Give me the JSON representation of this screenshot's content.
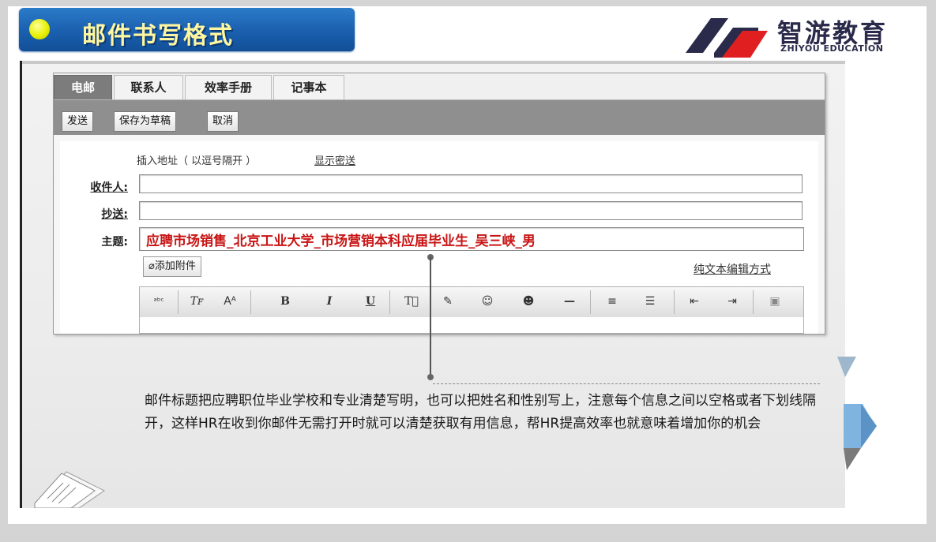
{
  "slide": {
    "title": "邮件书写格式",
    "logo": {
      "cn": "智游教育",
      "en": "ZHIYOU  EDUCATION"
    }
  },
  "mail_client": {
    "tabs": [
      {
        "label": "电邮",
        "active": true
      },
      {
        "label": "联系人",
        "active": false
      },
      {
        "label": "效率手册",
        "active": false
      },
      {
        "label": "记事本",
        "active": false
      }
    ],
    "toolbar": {
      "send": "发送",
      "save_draft": "保存为草稿",
      "cancel": "取消"
    },
    "compose": {
      "address_hint": "插入地址（ 以逗号隔开 ）",
      "show_bcc": "显示密送",
      "to_label": "收件人:",
      "to_value": "",
      "cc_label": "抄送:",
      "cc_value": "",
      "subject_label": "主题:",
      "subject_value": "应聘市场销售_北京工业大学_市场营销本科应届毕业生_吴三峡_男",
      "attach": "添加附件",
      "plain_text_mode": "纯文本编辑方式"
    },
    "editor_toolbar": [
      "spellcheck-icon",
      "font-icon",
      "font-size-icon",
      "bold-icon",
      "italic-icon",
      "underline-icon",
      "text-color-icon",
      "highlight-icon",
      "emoticon-icon",
      "emoticon-alt-icon",
      "horizontal-rule-icon",
      "align-icon",
      "list-icon",
      "outdent-icon",
      "indent-icon",
      "image-icon"
    ],
    "editor_glyphs": {
      "bold": "B",
      "italic": "I",
      "underline": "U",
      "rule": "—"
    }
  },
  "annotation": {
    "text": "邮件标题把应聘职位毕业学校和专业清楚写明，也可以把姓名和性别写上，注意每个信息之间以空格或者下划线隔开，这样HR在收到你邮件无需打开时就可以清楚获取有用信息，帮HR提高效率也就意味着增加你的机会"
  },
  "colors": {
    "title_banner": "#1a5fae",
    "title_text": "#fff6a0",
    "subject_text": "#c81414",
    "toolbar_bg": "#8f8f8f"
  }
}
